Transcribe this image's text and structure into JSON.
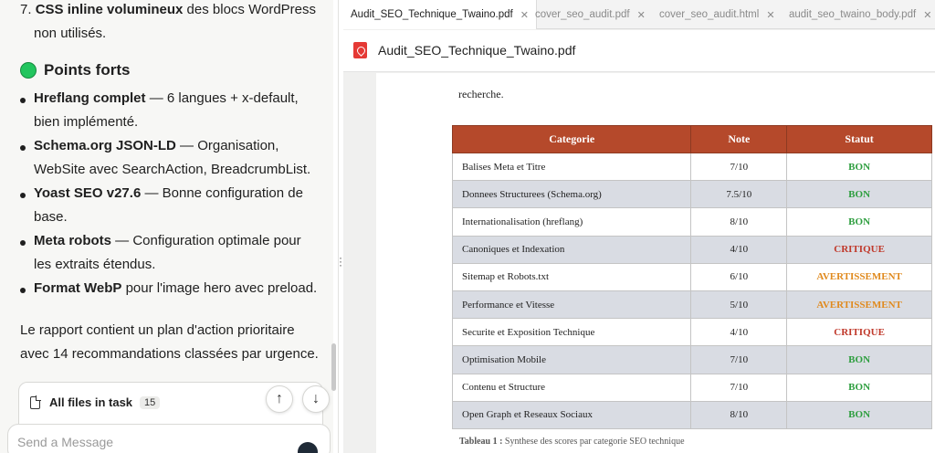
{
  "chat": {
    "list_item_7": {
      "number": "7.",
      "bold": "CSS inline volumineux",
      "rest": " des blocs WordPress",
      "line2": "non utilisés."
    },
    "strengths_heading": "Points forts",
    "strengths": [
      {
        "bold": "Hreflang complet",
        "rest": " — 6 langues + x-default,",
        "line2": "bien implémenté."
      },
      {
        "bold": "Schema.org JSON-LD",
        "rest": " — Organisation,",
        "line2": "WebSite avec SearchAction, BreadcrumbList."
      },
      {
        "bold": "Yoast SEO v27.6",
        "rest": " — Bonne configuration de",
        "line2": "base."
      },
      {
        "bold": "Meta robots",
        "rest": " — Configuration optimale pour",
        "line2": "les extraits étendus."
      },
      {
        "bold": "Format WebP",
        "rest": " pour l'image hero avec preload.",
        "line2": ""
      }
    ],
    "summary_line1": "Le rapport contient un plan d'action prioritaire",
    "summary_line2": "avec 14 recommandations classées par urgence.",
    "files_label": "All files in task",
    "files_count": "15",
    "message_placeholder": "Send a Message"
  },
  "tabs": [
    {
      "label": "Audit_SEO_Technique_Twaino.pdf",
      "active": true
    },
    {
      "label": "cover_seo_audit.pdf",
      "active": false
    },
    {
      "label": "cover_seo_audit.html",
      "active": false
    },
    {
      "label": "audit_seo_twaino_body.pdf",
      "active": false
    }
  ],
  "viewer": {
    "file_title": "Audit_SEO_Technique_Twaino.pdf",
    "page_text": "recherche.",
    "table": {
      "headers": [
        "Categorie",
        "Note",
        "Statut"
      ],
      "rows": [
        {
          "categorie": "Balises Meta et Titre",
          "note": "7/10",
          "statut": "BON"
        },
        {
          "categorie": "Donnees Structurees (Schema.org)",
          "note": "7.5/10",
          "statut": "BON"
        },
        {
          "categorie": "Internationalisation (hreflang)",
          "note": "8/10",
          "statut": "BON"
        },
        {
          "categorie": "Canoniques et Indexation",
          "note": "4/10",
          "statut": "CRITIQUE"
        },
        {
          "categorie": "Sitemap et Robots.txt",
          "note": "6/10",
          "statut": "AVERTISSEMENT"
        },
        {
          "categorie": "Performance et Vitesse",
          "note": "5/10",
          "statut": "AVERTISSEMENT"
        },
        {
          "categorie": "Securite et Exposition Technique",
          "note": "4/10",
          "statut": "CRITIQUE"
        },
        {
          "categorie": "Optimisation Mobile",
          "note": "7/10",
          "statut": "BON"
        },
        {
          "categorie": "Contenu et Structure",
          "note": "7/10",
          "statut": "BON"
        },
        {
          "categorie": "Open Graph et Reseaux Sociaux",
          "note": "8/10",
          "statut": "BON"
        }
      ]
    },
    "caption_bold": "Tableau 1 :",
    "caption_rest": " Synthese des scores par categorie SEO technique"
  },
  "colors": {
    "table_header": "#b5492b",
    "status_bon": "#2e9e3f",
    "status_critique": "#c0392b",
    "status_avertissement": "#e08a1e",
    "green_circle": "#22c55e"
  }
}
